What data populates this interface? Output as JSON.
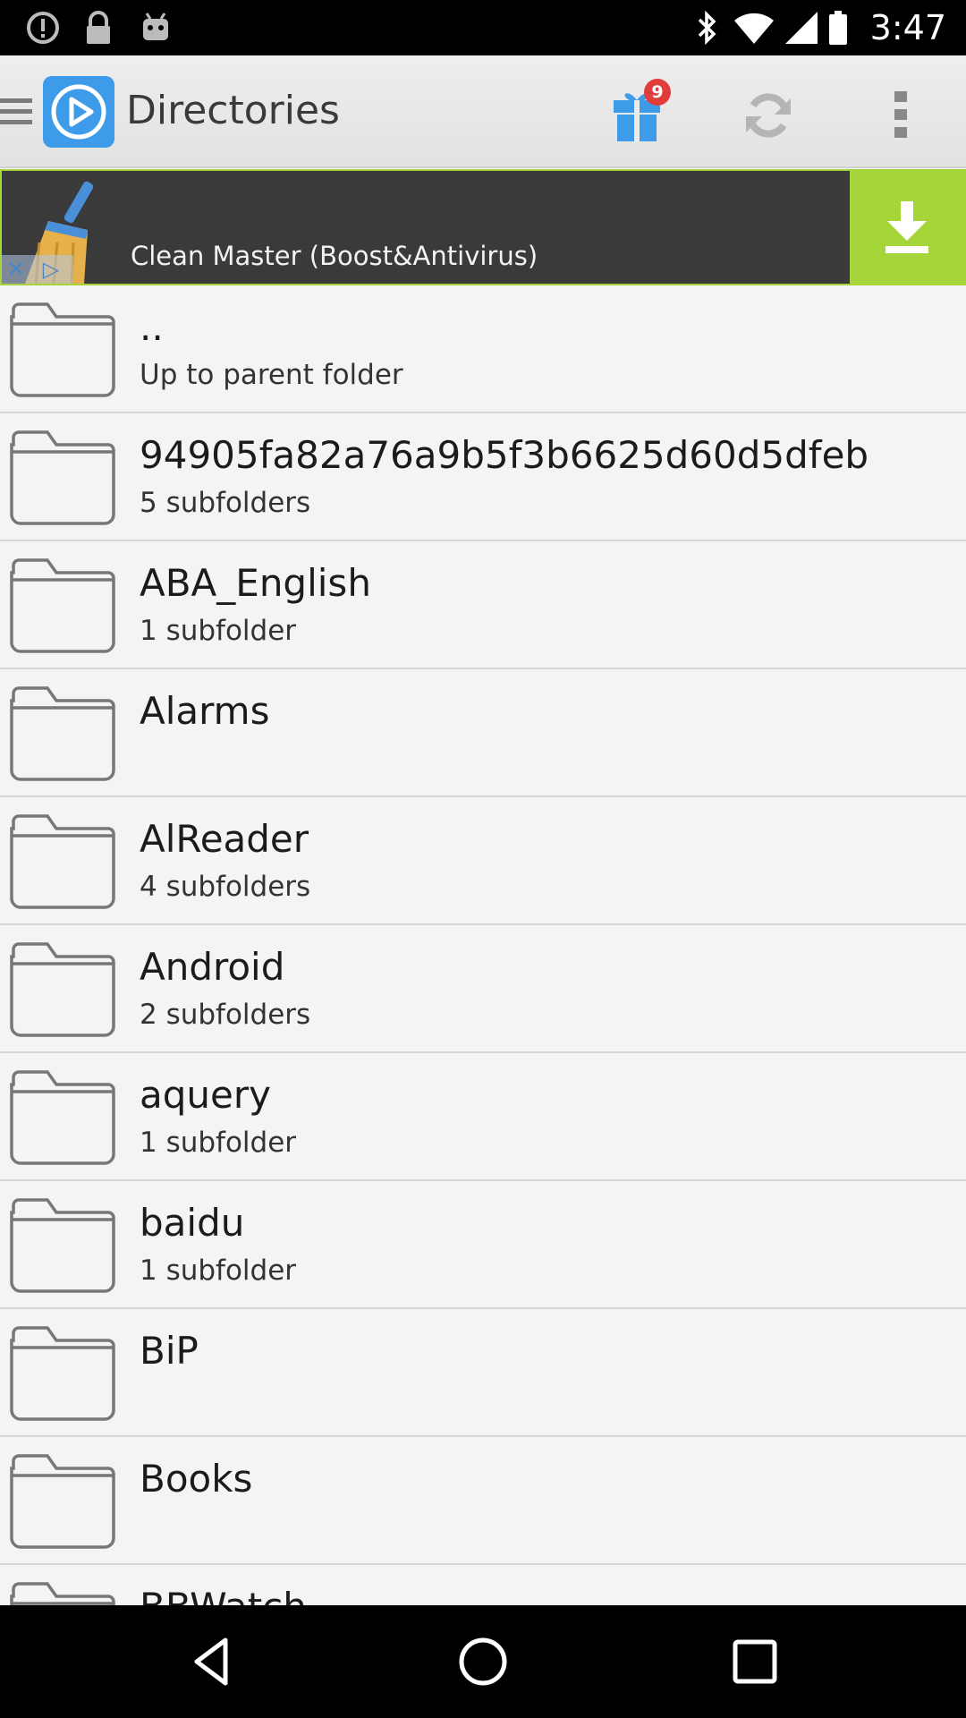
{
  "status_bar": {
    "time": "3:47",
    "icons": [
      "alert-circle-icon",
      "lock-icon",
      "android-icon",
      "bluetooth-icon",
      "wifi-icon",
      "signal-icon",
      "battery-icon"
    ]
  },
  "action_bar": {
    "title": "Directories",
    "gift_badge_count": "9",
    "icons": [
      "menu-icon",
      "play-logo-icon",
      "gift-icon",
      "refresh-icon",
      "overflow-menu-icon"
    ],
    "accent_color": "#3e9be9"
  },
  "ad": {
    "text": "Clean Master (Boost&Antivirus)",
    "download_color": "#a6d53a",
    "close_label": "✕ ▷"
  },
  "directories": [
    {
      "name": "..",
      "subtitle": "Up to parent folder"
    },
    {
      "name": "94905fa82a76a9b5f3b6625d60d5dfeb",
      "subtitle": "5 subfolders"
    },
    {
      "name": "ABA_English",
      "subtitle": "1 subfolder"
    },
    {
      "name": "Alarms",
      "subtitle": ""
    },
    {
      "name": "AlReader",
      "subtitle": "4 subfolders"
    },
    {
      "name": "Android",
      "subtitle": "2 subfolders"
    },
    {
      "name": "aquery",
      "subtitle": "1 subfolder"
    },
    {
      "name": "baidu",
      "subtitle": "1 subfolder"
    },
    {
      "name": "BiP",
      "subtitle": ""
    },
    {
      "name": "Books",
      "subtitle": ""
    },
    {
      "name": "BBWatch",
      "subtitle": ""
    }
  ],
  "nav_bar": {
    "icons": [
      "back-icon",
      "home-icon",
      "recents-icon"
    ]
  }
}
